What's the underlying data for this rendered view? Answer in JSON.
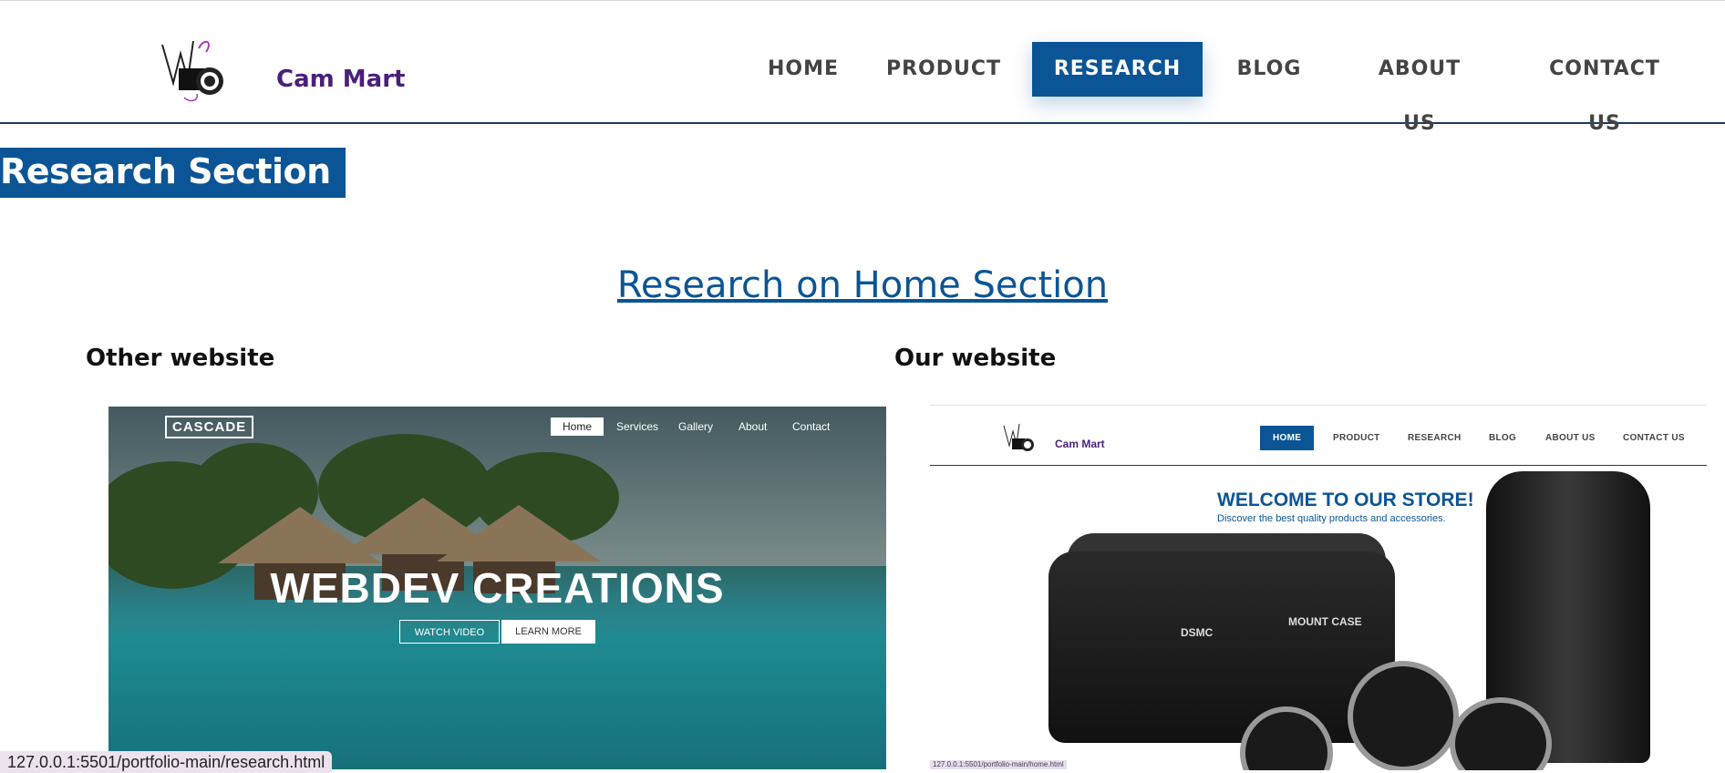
{
  "header": {
    "brand": "Cam Mart",
    "nav": [
      "HOME",
      "PRODUCT",
      "RESEARCH",
      "BLOG",
      "ABOUT US",
      "CONTACT US"
    ],
    "active_nav": "RESEARCH",
    "colors": {
      "accent": "#0b5596",
      "brand": "#4a1f7a",
      "divider": "#1b3a66"
    }
  },
  "banner": {
    "title": "Research Section"
  },
  "section": {
    "heading": "Research on Home Section"
  },
  "columns": {
    "other": "Other website",
    "ours": "Our website"
  },
  "other_site": {
    "logo": "CASCADE",
    "nav": [
      "Home",
      "Services",
      "Gallery",
      "About",
      "Contact"
    ],
    "hero_title": "WEBDEV CREATIONS",
    "watch_button": "WATCH VIDEO",
    "learn_button": "LEARN MORE"
  },
  "our_site": {
    "brand": "Cam Mart",
    "nav": [
      "HOME",
      "PRODUCT",
      "RESEARCH",
      "BLOG",
      "ABOUT US",
      "CONTACT US"
    ],
    "welcome": "WELCOME TO OUR STORE!",
    "subtitle": "Discover the best quality products and accessories.",
    "case_label_left": "DSMC",
    "case_label_right": "MOUNT CASE",
    "status_url": "127.0.0.1:5501/portfolio-main/home.html"
  },
  "status_bar": {
    "url": "127.0.0.1:5501/portfolio-main/research.html"
  }
}
